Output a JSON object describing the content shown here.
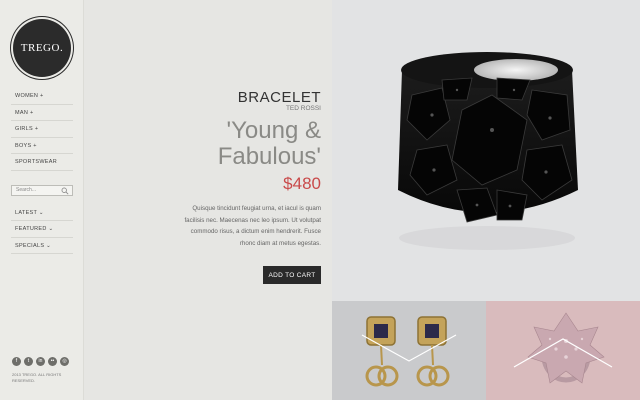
{
  "logo": {
    "text": "TREGO."
  },
  "nav": {
    "items": [
      {
        "label": "WOMEN +"
      },
      {
        "label": "MAN +"
      },
      {
        "label": "GIRLS +"
      },
      {
        "label": "BOYS +"
      },
      {
        "label": "SPORTSWEAR"
      }
    ]
  },
  "search": {
    "placeholder": "Search..."
  },
  "nav2": {
    "items": [
      {
        "label": "LATEST ⌄"
      },
      {
        "label": "FEATURED ⌄"
      },
      {
        "label": "SPECIALS ⌄"
      }
    ]
  },
  "social": {
    "icons": [
      "facebook-icon",
      "twitter-icon",
      "linkedin-icon",
      "flickr-icon",
      "dribbble-icon"
    ],
    "glyphs": [
      "f",
      "t",
      "in",
      "••",
      "◎"
    ]
  },
  "footer": {
    "copyright": "2013 TREGO. ALL RIGHTS RESERVED."
  },
  "product": {
    "title": "BRACELET",
    "brand": "TED ROSSI",
    "tagline": "'Young & Fabulous'",
    "price": "$480",
    "description": "Quisque tincidunt feugiat urna, et iacul is quam facilisis nec. Maecenas nec leo ipsum. Ut volutpat commodo risus, a dictum enim hendrerit. Fusce rhonc diam at metus egestas.",
    "cart_label": "ADD TO CART"
  },
  "colors": {
    "accent_price": "#c94a4a",
    "button_bg": "#2a2a2a",
    "thumb_pink": "#d9bbbd"
  }
}
